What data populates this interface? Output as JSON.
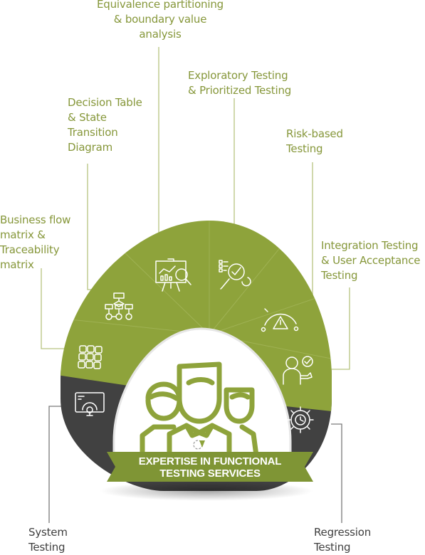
{
  "colors": {
    "green": "#8ea33b",
    "green_label": "#86973a",
    "dark": "#414141",
    "line_green": "#b7c480",
    "line_dark": "#7a7a7a",
    "banner": "#7f9535"
  },
  "title": {
    "line1": "EXPERTISE IN FUNCTIONAL",
    "line2": "TESTING SERVICES"
  },
  "segments": [
    {
      "label": "System\nTesting",
      "icon": "monitor-gear-icon",
      "tone": "dark"
    },
    {
      "label": "Business flow\nmatrix &\nTraceability\nmatrix",
      "icon": "grid-matrix-icon",
      "tone": "green"
    },
    {
      "label": "Decision Table\n& State\nTransition\nDiagram",
      "icon": "flowchart-icon",
      "tone": "green"
    },
    {
      "label": "Equivalence partitioning\n& boundary value\nanalysis",
      "icon": "presentation-analysis-icon",
      "tone": "green"
    },
    {
      "label": "Exploratory Testing\n& Prioritized Testing",
      "icon": "checklist-magnifier-icon",
      "tone": "green"
    },
    {
      "label": "Risk-based\nTesting",
      "icon": "risk-gauge-icon",
      "tone": "green"
    },
    {
      "label": "Integration Testing\n& User Acceptance\nTesting",
      "icon": "user-approval-icon",
      "tone": "green"
    },
    {
      "label": "Regression\nTesting",
      "icon": "gear-clock-icon",
      "tone": "dark"
    }
  ],
  "center_icon": "team-people-icon"
}
